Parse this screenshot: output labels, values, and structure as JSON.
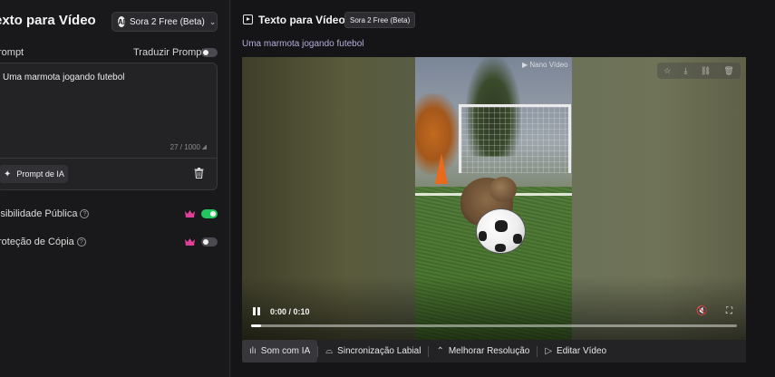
{
  "left_panel": {
    "title": "exto para Vídeo",
    "model": {
      "label": "Sora 2 Free (Beta)",
      "logo_text": "AI"
    },
    "prompt_label": "rompt",
    "translate_label": "Traduzir Prompt",
    "translate_on": false,
    "prompt_value": "Uma marmota jogando futebol",
    "char_counter": "27 / 1000",
    "ai_prompt_button": "Prompt de IA",
    "public_visibility": {
      "label": "isibilidade Pública",
      "on": true
    },
    "copy_protection": {
      "label": "roteção de Cópia",
      "on": false
    },
    "help_glyph": "?"
  },
  "right_panel": {
    "title": "Texto para Vídeo",
    "badge": "Sora 2 Free (Beta)",
    "caption": "Uma marmota jogando futebol",
    "player": {
      "watermark": "Nano Vídeo",
      "time": "0:00 / 0:10",
      "progress": 0.02
    },
    "tools": [
      {
        "label": "Som com IA",
        "icon": "audio-wave-icon",
        "active": true
      },
      {
        "label": "Sincronização Labial",
        "icon": "lips-icon",
        "active": false
      },
      {
        "label": "Melhorar Resolução",
        "icon": "upscale-icon",
        "active": false
      },
      {
        "label": "Editar Vídeo",
        "icon": "edit-video-icon",
        "active": false
      }
    ]
  },
  "colors": {
    "toggle_on": "#22c55e",
    "crown": "#e0409a",
    "accent_text": "#b5aeda"
  }
}
